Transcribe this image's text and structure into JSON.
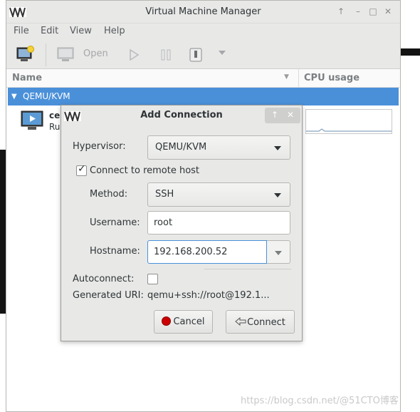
{
  "main_window": {
    "title": "Virtual Machine Manager",
    "menu": [
      "File",
      "Edit",
      "View",
      "Help"
    ],
    "toolbar": {
      "open_label": "Open"
    },
    "columns": {
      "name": "Name",
      "cpu": "CPU usage"
    },
    "group": {
      "label": "QEMU/KVM"
    },
    "vm": {
      "name": "ce",
      "status": "Ru"
    }
  },
  "dialog": {
    "title": "Add Connection",
    "hypervisor_label": "Hypervisor:",
    "hypervisor_value": "QEMU/KVM",
    "remote_checkbox_label": "Connect to remote host",
    "remote_checked": true,
    "method_label": "Method:",
    "method_value": "SSH",
    "username_label": "Username:",
    "username_value": "root",
    "hostname_label": "Hostname:",
    "hostname_value": "192.168.200.52",
    "autoconnect_label": "Autoconnect:",
    "autoconnect_checked": false,
    "uri_label": "Generated URI:",
    "uri_value": "qemu+ssh://root@192.1...",
    "cancel_label": "Cancel",
    "connect_label": "Connect"
  },
  "watermark": "https://blog.csdn.net/@51CTO博客",
  "colors": {
    "selection": "#4a90d9",
    "window_bg": "#e8e8e7",
    "cancel_icon": "#cc0000"
  }
}
